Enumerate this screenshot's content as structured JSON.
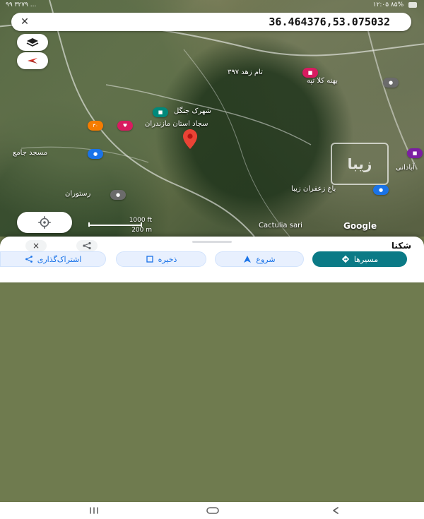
{
  "status_bar": {
    "left": "۹۹ ۳۲۷۹ ...",
    "right": "۱۲:۰۵ ۸۵%"
  },
  "search": {
    "value": "36.464376,53.075032",
    "close_icon": "close-icon"
  },
  "map": {
    "labels": [
      {
        "name": "place-label-1",
        "text": "تام زهد ۳۹۷"
      },
      {
        "name": "place-label-2",
        "text": "بهنه کلا تپه"
      },
      {
        "name": "place-label-3",
        "text": "شهرک جنگل"
      },
      {
        "name": "place-label-4",
        "text": "سجاد استان مازندران"
      },
      {
        "name": "place-label-5",
        "text": "مسجد جامع"
      },
      {
        "name": "place-label-6",
        "text": "رستوران"
      },
      {
        "name": "place-label-7",
        "text": "آبادانی"
      },
      {
        "name": "place-label-8",
        "text": "باغ زعفران زیبا"
      },
      {
        "name": "place-label-9",
        "text": "Cactulia sari"
      }
    ],
    "scale": {
      "top": "1000 ft",
      "bottom": "200 m"
    },
    "watermark": "زیبا",
    "google_logo": "Google"
  },
  "bottom_sheet": {
    "title": "شکنا",
    "close": "×",
    "share_icon": "share-icon",
    "actions": {
      "share": "اشتراک‌گذاری",
      "save": "ذخیره",
      "start": "شروع",
      "directions": "مسیرها"
    }
  }
}
